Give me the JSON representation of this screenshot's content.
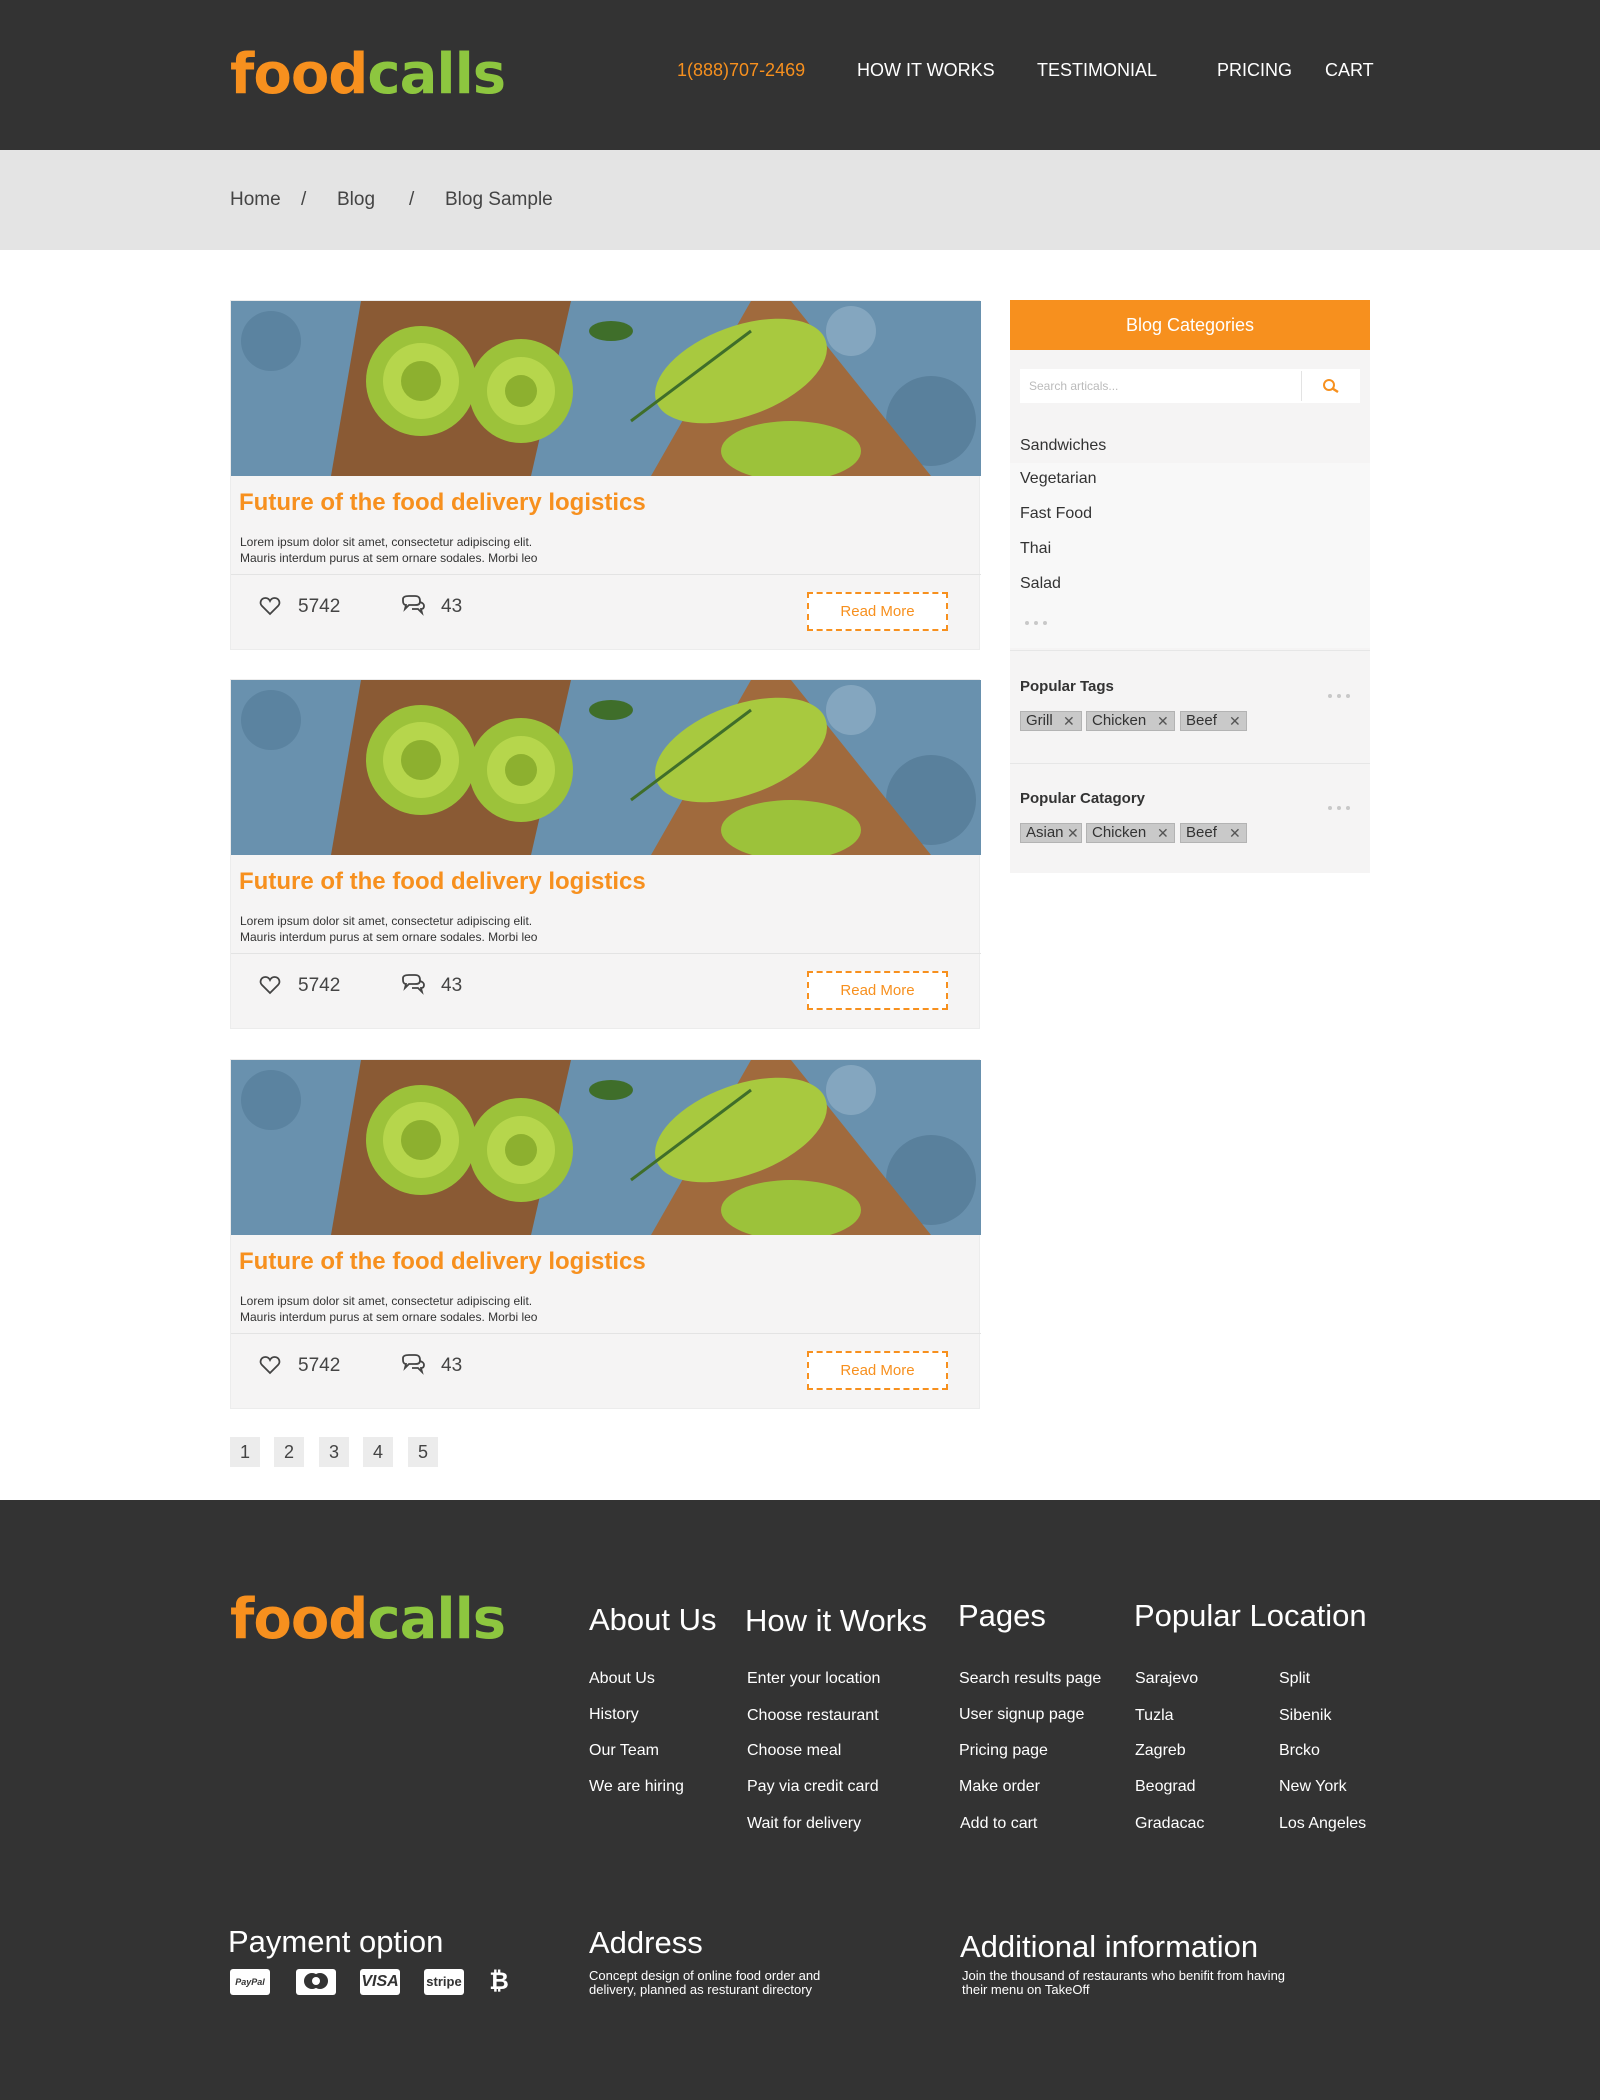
{
  "header": {
    "logo_food": "food",
    "logo_calls": "calls",
    "phone": "1(888)707-2469",
    "nav": [
      "HOW IT WORKS",
      "TESTIMONIAL",
      "PRICING",
      "CART"
    ]
  },
  "breadcrumb": {
    "items": [
      "Home",
      "Blog",
      "Blog Sample"
    ],
    "separator": "/"
  },
  "posts": [
    {
      "title": "Future of the food delivery logistics",
      "text_line1": "Lorem ipsum dolor sit amet, consectetur adipiscing elit.",
      "text_line2": "Mauris  interdum purus at sem ornare sodales.  Morbi leo",
      "likes": "5742",
      "comments": "43",
      "read_more": "Read More"
    },
    {
      "title": "Future of the food delivery logistics",
      "text_line1": "Lorem ipsum dolor sit amet, consectetur adipiscing elit.",
      "text_line2": "Mauris  interdum purus at sem ornare sodales.  Morbi leo",
      "likes": "5742",
      "comments": "43",
      "read_more": "Read More"
    },
    {
      "title": "Future of the food delivery logistics",
      "text_line1": "Lorem ipsum dolor sit amet, consectetur adipiscing elit.",
      "text_line2": "Mauris  interdum purus at sem ornare sodales.  Morbi leo",
      "likes": "5742",
      "comments": "43",
      "read_more": "Read More"
    }
  ],
  "pagination": [
    "1",
    "2",
    "3",
    "4",
    "5"
  ],
  "sidebar": {
    "title": "Blog Categories",
    "search_placeholder": "Search articals...",
    "categories": [
      "Sandwiches",
      "Vegetarian",
      "Fast Food",
      "Thai",
      "Salad"
    ],
    "popular_tags_label": "Popular Tags",
    "popular_tags": [
      "Grill",
      "Chicken",
      "Beef"
    ],
    "popular_category_label": "Popular Catagory",
    "popular_categories": [
      "Asian",
      "Chicken",
      "Beef"
    ]
  },
  "footer": {
    "logo_food": "food",
    "logo_calls": "calls",
    "about": {
      "heading": "About Us",
      "links": [
        "About Us",
        "History",
        "Our Team",
        "We are hiring"
      ]
    },
    "how": {
      "heading": "How it Works",
      "links": [
        "Enter your location",
        "Choose restaurant",
        "Choose meal",
        "Pay via credit card",
        "Wait for delivery"
      ]
    },
    "pages": {
      "heading": "Pages",
      "links": [
        "Search results page",
        "User signup page",
        "Pricing page",
        "Make order",
        "Add to cart"
      ]
    },
    "locations": {
      "heading": "Popular Location",
      "col1": [
        "Sarajevo",
        "Tuzla",
        "Zagreb",
        "Beograd",
        "Gradacac"
      ],
      "col2": [
        "Split",
        "Sibenik",
        "Brcko",
        "New York",
        "Los Angeles"
      ]
    },
    "payment": {
      "heading": "Payment option",
      "icons": [
        "paypal-icon",
        "mastercard-icon",
        "visa-icon",
        "stripe-icon",
        "bitcoin-icon"
      ],
      "paypal": "PayPal",
      "visa": "VISA",
      "stripe": "stripe",
      "bitcoin": "₿"
    },
    "address": {
      "heading": "Address",
      "line1": "Concept design of online food order and",
      "line2": "delivery, planned as resturant directory"
    },
    "additional": {
      "heading": "Additional information",
      "line1": "Join the thousand of restaurants who benifit from having",
      "line2": "their menu on TakeOff"
    }
  },
  "colors": {
    "accent": "#f7901e",
    "brand_green": "#8dc63f",
    "dark": "#333333"
  }
}
